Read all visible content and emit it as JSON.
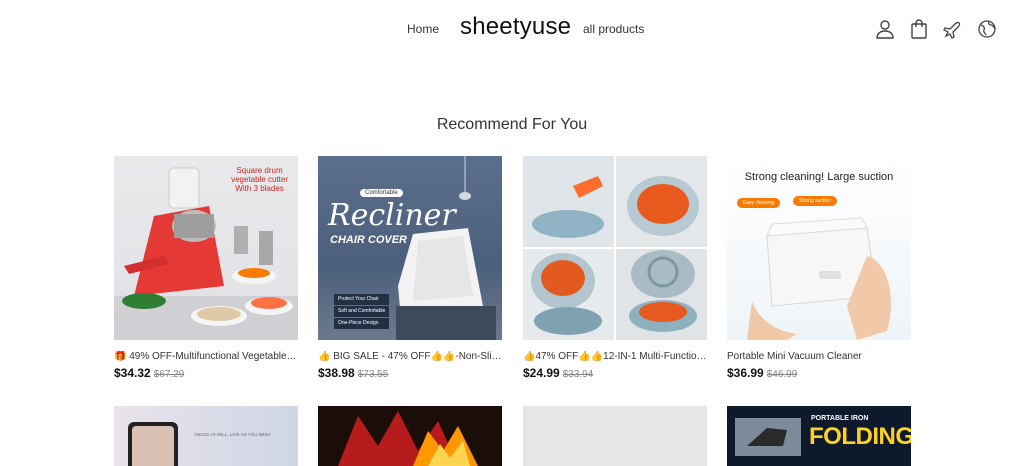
{
  "header": {
    "nav_home": "Home",
    "logo": "sheetyuse",
    "nav_all_products": "all products",
    "icons": [
      "user-icon",
      "bag-icon",
      "plane-icon",
      "globe-icon"
    ]
  },
  "section": {
    "title": "Recommend For You"
  },
  "products": [
    {
      "title": "🎁 49% OFF-Multifunctional Vegetable C...",
      "price": "$34.32",
      "old_price": "$67.29",
      "image_text": [
        "Square drum",
        "vegetable cutter",
        "With 3 blades"
      ]
    },
    {
      "title": "👍 BIG SALE - 47% OFF👍👍-Non-Slip Re...",
      "price": "$38.98",
      "old_price": "$73.55",
      "image_text": [
        "Comfortable",
        "Recliner",
        "CHAIR COVER",
        "Protect Your Chair",
        "Soft and Comfortable",
        "One-Piece Design"
      ]
    },
    {
      "title": "👍47% OFF👍👍12-IN-1 Multi-Function F...",
      "price": "$24.99",
      "old_price": "$33.94"
    },
    {
      "title": "Portable Mini Vacuum Cleaner",
      "price": "$36.99",
      "old_price": "$46.99",
      "image_text": [
        "Strong cleaning! Large suction",
        "Easy cleaning",
        "Strong suction"
      ]
    }
  ],
  "row2": [
    {
      "image_text": "ANGLE AT WILL, LIVE AS YOU WISH"
    },
    {
      "image_text": ""
    },
    {
      "image_text": ""
    },
    {
      "image_text": [
        "PORTABLE IRON",
        "FOLDING"
      ]
    }
  ]
}
